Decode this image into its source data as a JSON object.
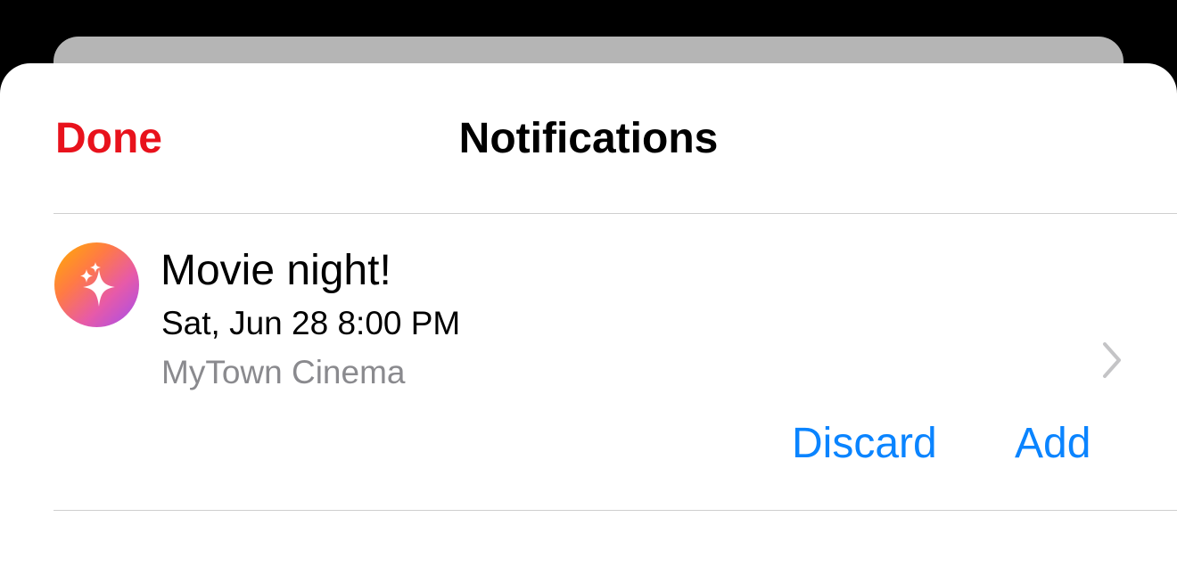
{
  "header": {
    "done_label": "Done",
    "title": "Notifications"
  },
  "notification": {
    "icon": "sparkles-icon",
    "title": "Movie night!",
    "datetime": "Sat, Jun 28 8:00 PM",
    "location": "MyTown Cinema",
    "discard_label": "Discard",
    "add_label": "Add"
  },
  "colors": {
    "done": "#e8121c",
    "action": "#0a84ff",
    "secondary_text": "#8a8a8e"
  }
}
